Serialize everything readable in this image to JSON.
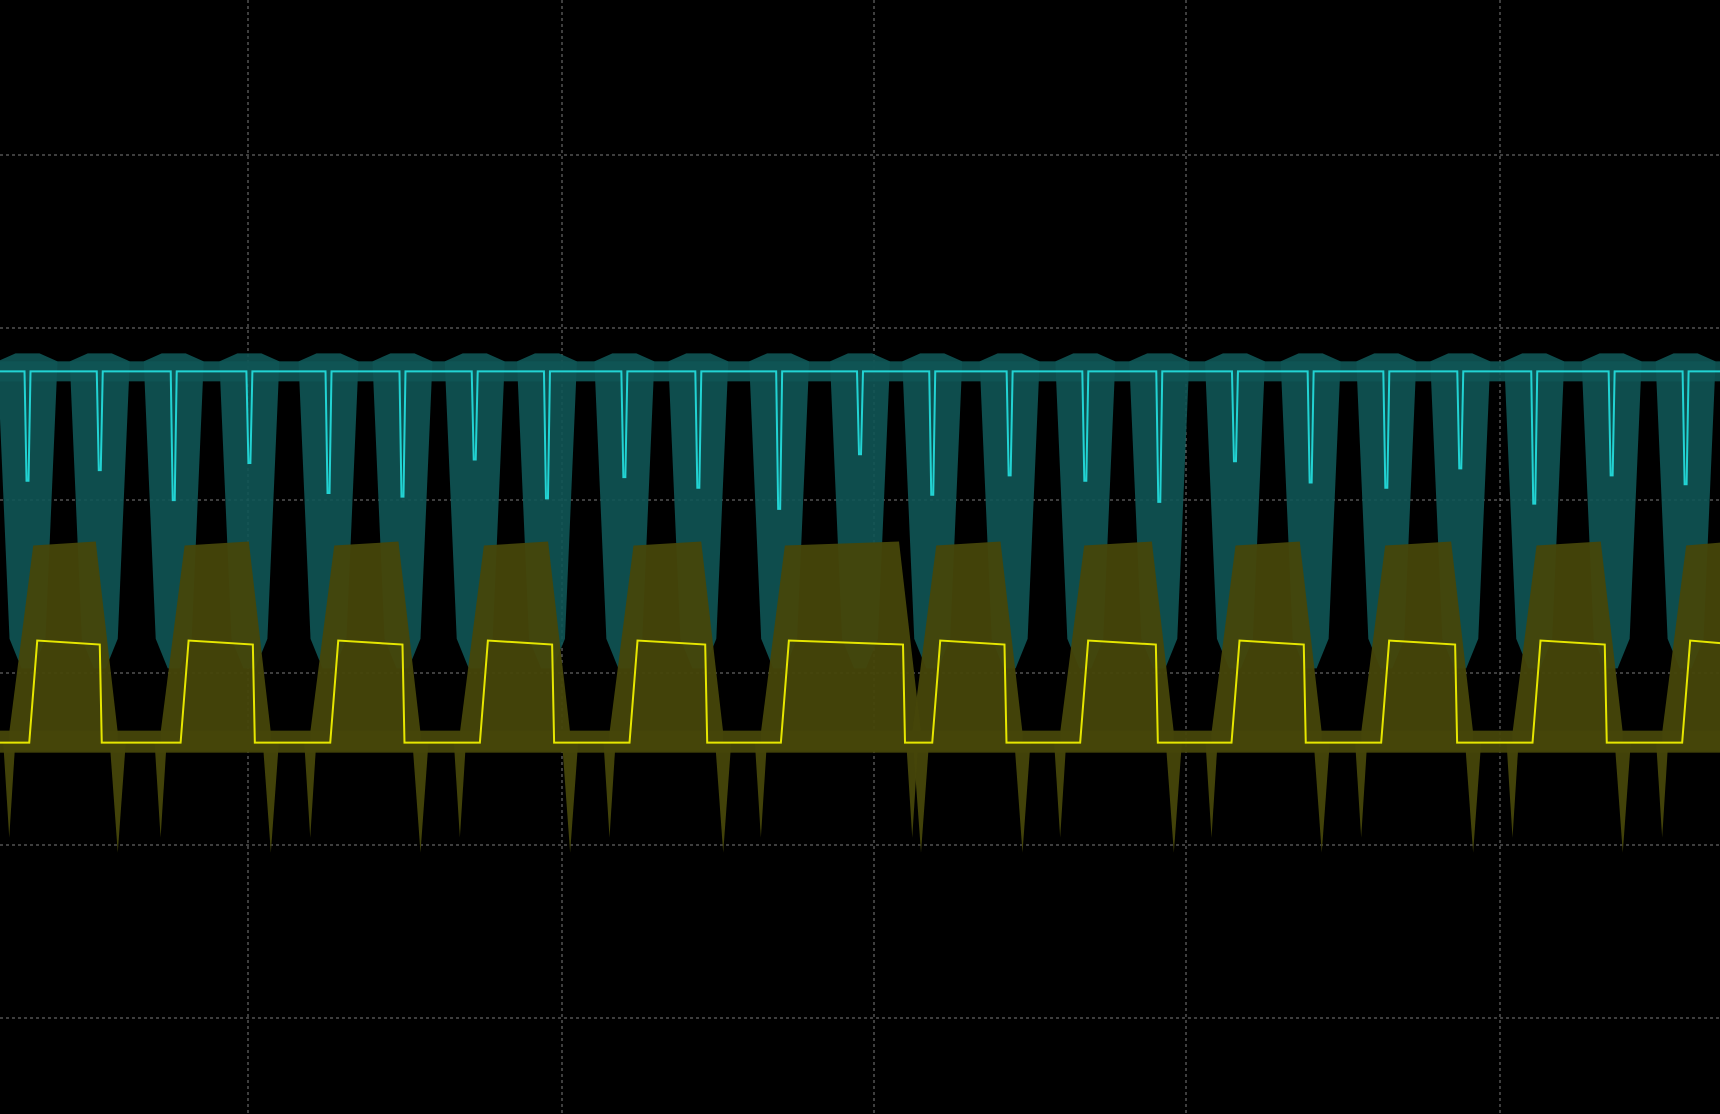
{
  "chart_data": {
    "type": "line",
    "grid": true,
    "grid_style": "dotted",
    "background": "#000000",
    "grid_color": "#9a9a9a",
    "series": [
      {
        "channel": "cyan",
        "color": "#22d3d3",
        "envelope_color": "#0f5555",
        "baseline_level": 1.0,
        "pulse_direction": "down",
        "pulse_widths": [
          0.008,
          0.022,
          0.04,
          0.03,
          0.06
        ],
        "pulse_depths": [
          0.6,
          0.8,
          0.95,
          1.4,
          1.0
        ],
        "pulses": [
          {
            "t": 0.16,
            "depth": 0.62
          },
          {
            "t": 0.58,
            "depth": 0.56
          },
          {
            "t": 1.01,
            "depth": 0.73
          },
          {
            "t": 1.45,
            "depth": 0.52
          },
          {
            "t": 1.91,
            "depth": 0.69
          },
          {
            "t": 2.34,
            "depth": 0.71
          },
          {
            "t": 2.76,
            "depth": 0.5
          },
          {
            "t": 3.18,
            "depth": 0.72
          },
          {
            "t": 3.63,
            "depth": 0.6
          },
          {
            "t": 4.06,
            "depth": 0.66
          },
          {
            "t": 4.53,
            "depth": 0.78
          },
          {
            "t": 5.0,
            "depth": 0.47
          },
          {
            "t": 5.42,
            "depth": 0.7
          },
          {
            "t": 5.87,
            "depth": 0.59
          },
          {
            "t": 6.31,
            "depth": 0.62
          },
          {
            "t": 6.74,
            "depth": 0.74
          },
          {
            "t": 7.18,
            "depth": 0.51
          },
          {
            "t": 7.62,
            "depth": 0.63
          },
          {
            "t": 8.06,
            "depth": 0.66
          },
          {
            "t": 8.49,
            "depth": 0.55
          },
          {
            "t": 8.92,
            "depth": 0.75
          },
          {
            "t": 9.37,
            "depth": 0.59
          },
          {
            "t": 9.8,
            "depth": 0.64
          }
        ]
      },
      {
        "channel": "yellow",
        "color": "#e6e600",
        "envelope_color": "#46460a",
        "low_level": -1.0,
        "high_level": -0.45,
        "pulses": [
          {
            "start": 0.17,
            "end": 0.58
          },
          {
            "start": 1.05,
            "end": 1.47
          },
          {
            "start": 1.92,
            "end": 2.34
          },
          {
            "start": 2.79,
            "end": 3.21
          },
          {
            "start": 3.66,
            "end": 4.1
          },
          {
            "start": 4.54,
            "end": 5.25
          },
          {
            "start": 5.42,
            "end": 5.84
          },
          {
            "start": 6.28,
            "end": 6.72
          },
          {
            "start": 7.16,
            "end": 7.58
          },
          {
            "start": 8.03,
            "end": 8.46
          },
          {
            "start": 8.91,
            "end": 9.33
          },
          {
            "start": 9.78,
            "end": 10.1
          }
        ]
      }
    ],
    "x_range": [
      0,
      10
    ],
    "y_range": [
      -3.0,
      3.0
    ]
  }
}
